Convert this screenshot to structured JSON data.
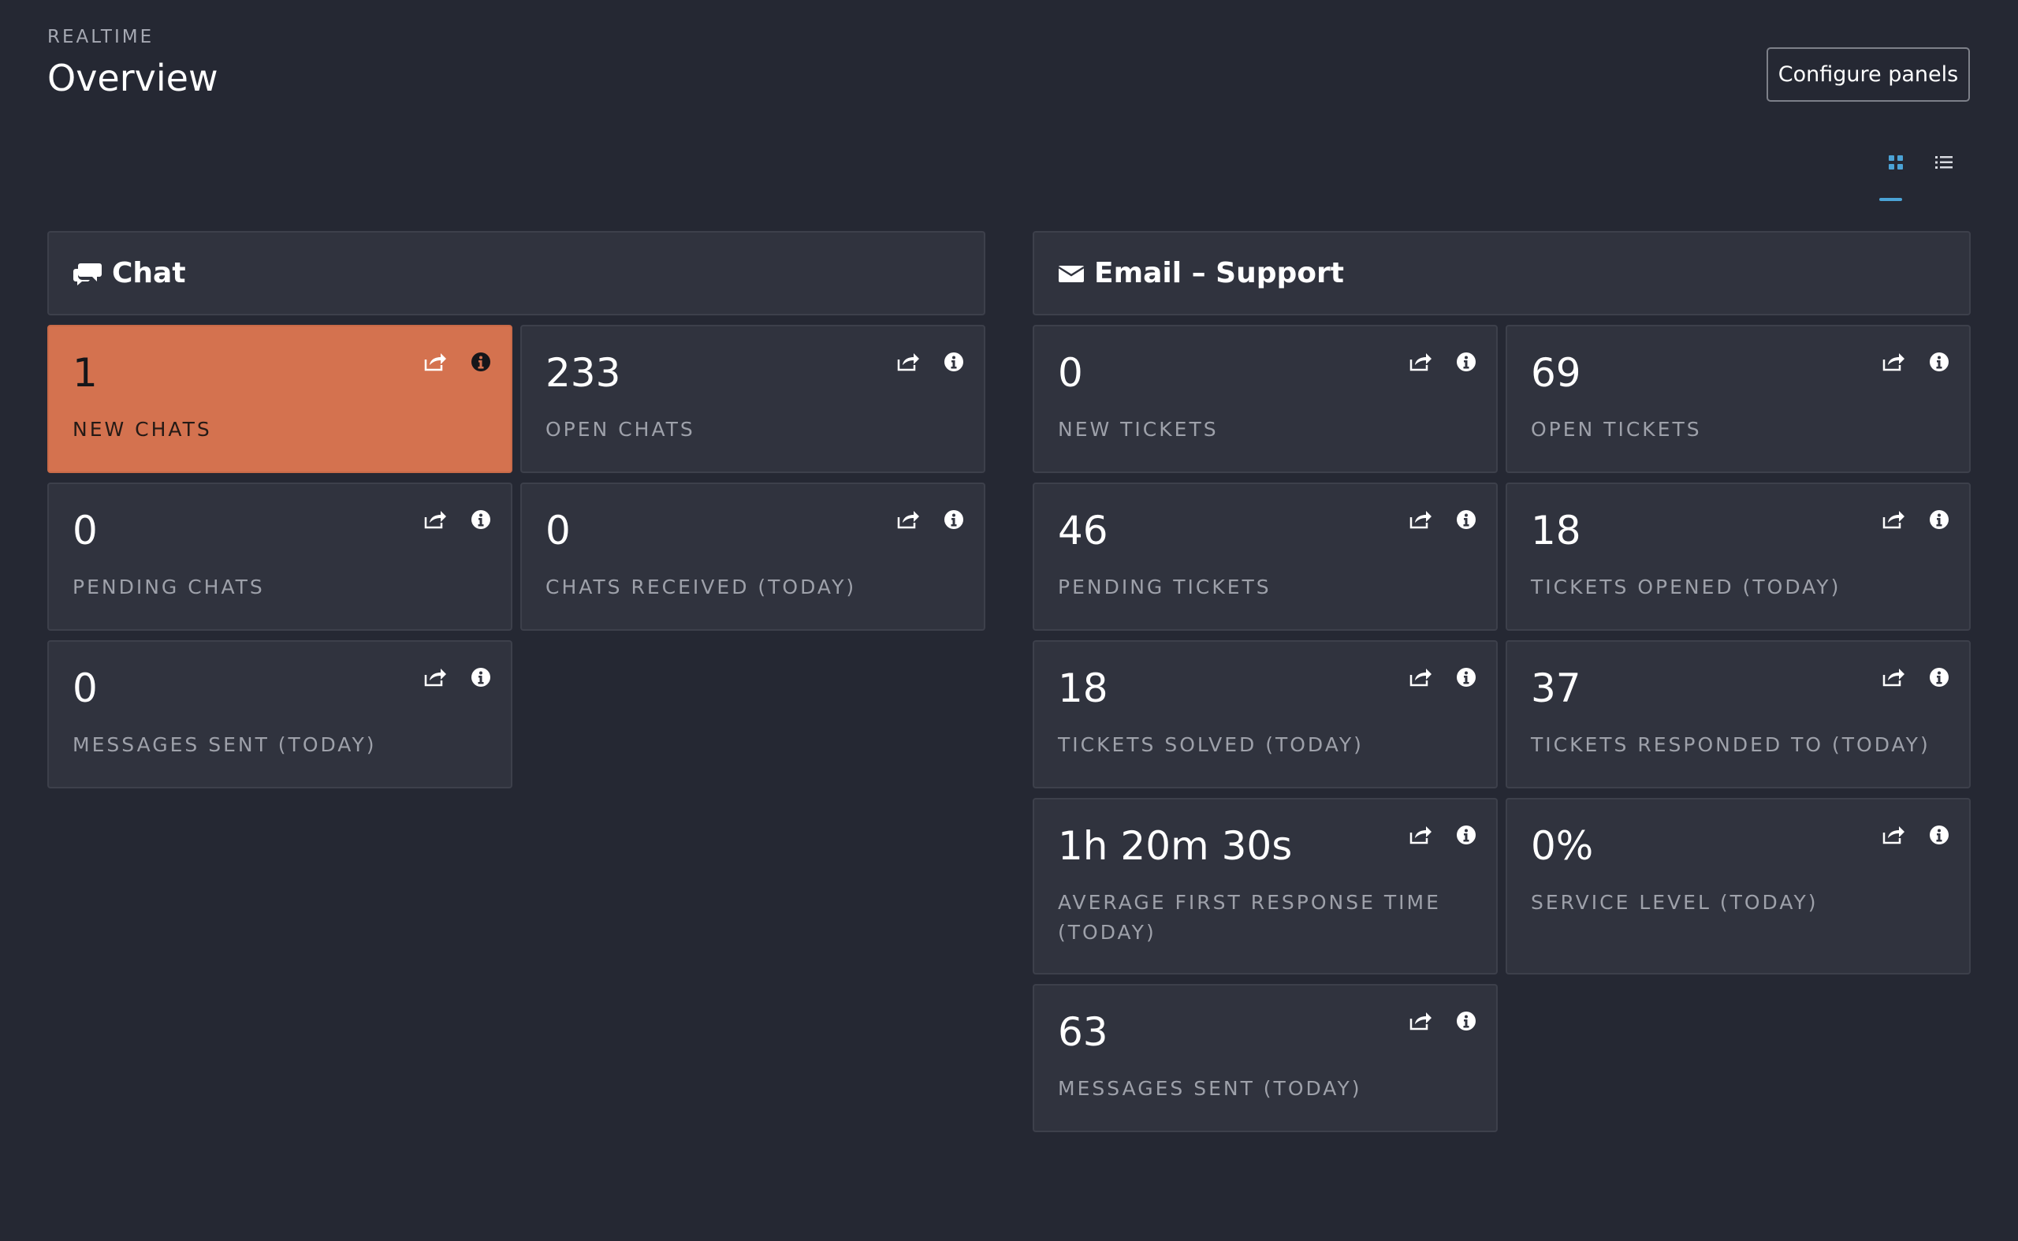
{
  "header": {
    "eyebrow": "REALTIME",
    "title": "Overview",
    "configure_label": "Configure panels"
  },
  "view_toggle": {
    "grid_icon": "grid-icon",
    "list_icon": "list-icon",
    "active": "grid"
  },
  "colors": {
    "background": "#252833",
    "panel": "#30333e",
    "highlight": "#d4724f",
    "accent": "#4ba3d6"
  },
  "sections": {
    "chat": {
      "title": "Chat",
      "icon": "chat-bubbles-icon",
      "metrics": [
        {
          "value": "1",
          "label": "NEW CHATS",
          "highlight": true
        },
        {
          "value": "233",
          "label": "OPEN CHATS"
        },
        {
          "value": "0",
          "label": "PENDING CHATS"
        },
        {
          "value": "0",
          "label": "CHATS RECEIVED (TODAY)"
        },
        {
          "value": "0",
          "label": "MESSAGES SENT (TODAY)"
        }
      ]
    },
    "email": {
      "title": "Email – Support",
      "icon": "envelope-icon",
      "metrics": [
        {
          "value": "0",
          "label": "NEW TICKETS"
        },
        {
          "value": "69",
          "label": "OPEN TICKETS"
        },
        {
          "value": "46",
          "label": "PENDING TICKETS"
        },
        {
          "value": "18",
          "label": "TICKETS OPENED (TODAY)"
        },
        {
          "value": "18",
          "label": "TICKETS SOLVED (TODAY)"
        },
        {
          "value": "37",
          "label": "TICKETS RESPONDED TO (TODAY)"
        },
        {
          "value": "1h 20m 30s",
          "label": "AVERAGE FIRST RESPONSE TIME (TODAY)"
        },
        {
          "value": "0%",
          "label": "SERVICE LEVEL (TODAY)"
        },
        {
          "value": "63",
          "label": "MESSAGES SENT (TODAY)"
        }
      ]
    }
  },
  "card_actions": {
    "share_icon": "share-icon",
    "info_icon": "info-icon"
  }
}
